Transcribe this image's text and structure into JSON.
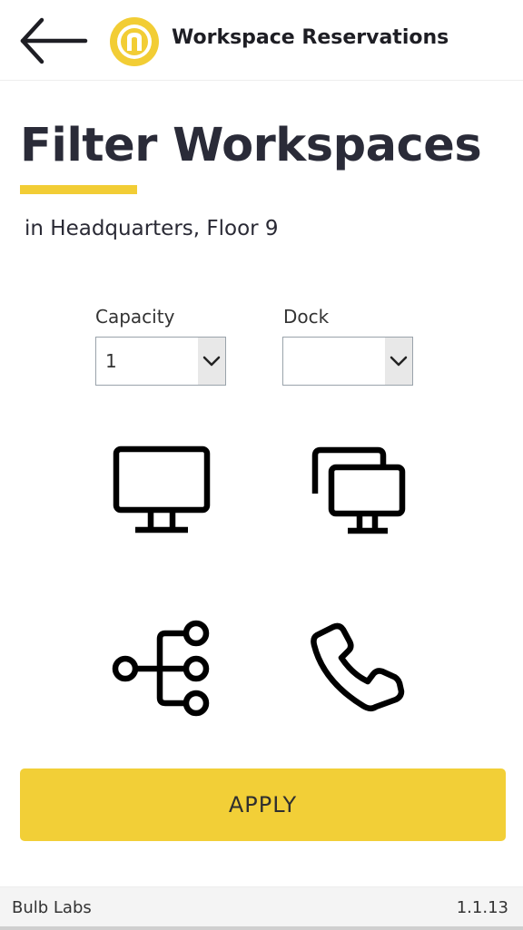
{
  "header": {
    "title": "Workspace Reservations",
    "back_icon": "arrow-left-icon",
    "logo_icon": "bulb-labs-logo-icon",
    "logo_color": "#f2cd35"
  },
  "page": {
    "title": "Filter Workspaces",
    "location": "in Headquarters, Floor 9",
    "accent_color": "#f2cd35"
  },
  "filters": {
    "capacity": {
      "label": "Capacity",
      "value": "1"
    },
    "dock": {
      "label": "Dock",
      "value": ""
    }
  },
  "amenities": [
    {
      "icon": "monitor-icon"
    },
    {
      "icon": "dual-monitor-icon"
    },
    {
      "icon": "network-hierarchy-icon"
    },
    {
      "icon": "phone-icon"
    }
  ],
  "actions": {
    "apply_label": "APPLY",
    "apply_color": "#f2cf37"
  },
  "footer": {
    "company": "Bulb Labs",
    "version": "1.1.13"
  }
}
